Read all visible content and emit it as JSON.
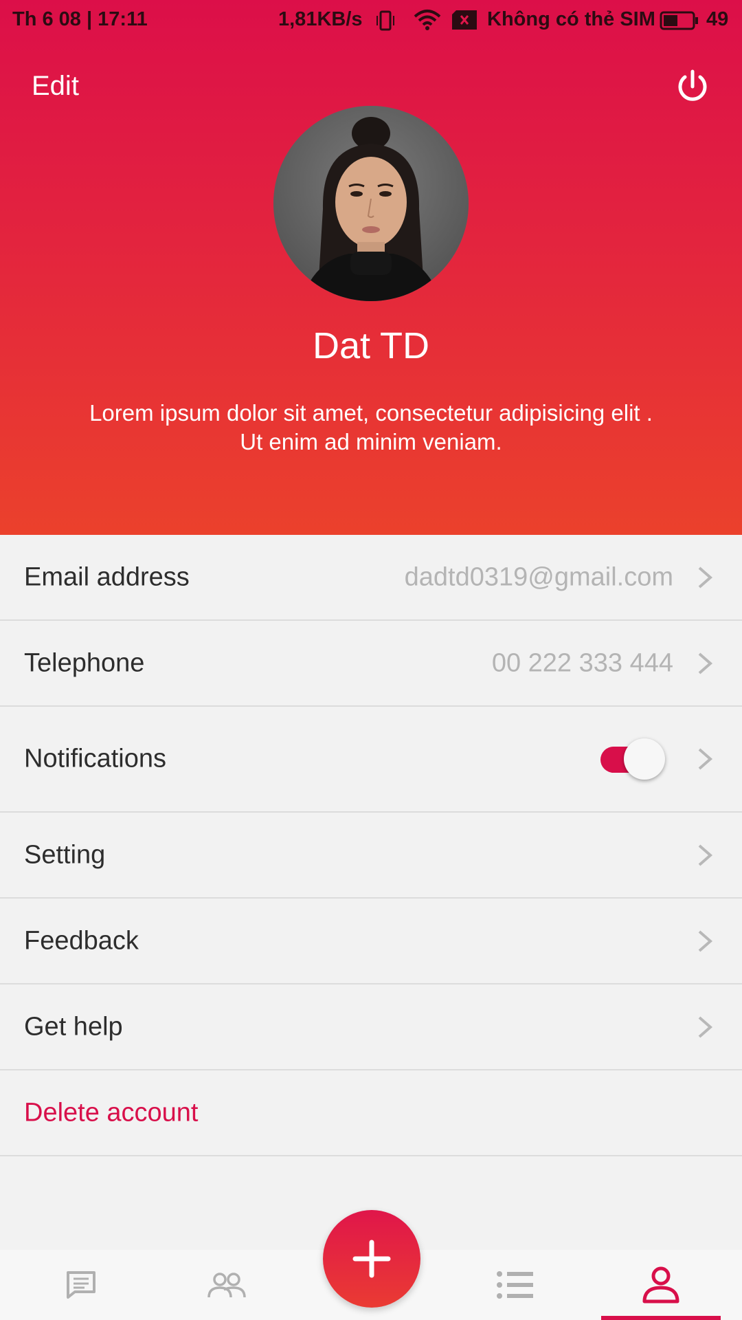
{
  "status_bar": {
    "datetime": "Th 6 08 | 17:11",
    "network_speed": "1,81KB/s",
    "carrier": "Không có thẻ SIM",
    "battery_level": "49"
  },
  "header": {
    "edit_label": "Edit",
    "name": "Dat TD",
    "bio_line1": "Lorem ipsum dolor sit amet, consectetur adipisicing elit .",
    "bio_line2": "Ut enim ad minim veniam."
  },
  "settings": {
    "email": {
      "label": "Email address",
      "value": "dadtd0319@gmail.com"
    },
    "telephone": {
      "label": "Telephone",
      "value": "00 222 333 444"
    },
    "notifications": {
      "label": "Notifications",
      "enabled": true
    },
    "setting": {
      "label": "Setting"
    },
    "feedback": {
      "label": "Feedback"
    },
    "help": {
      "label": "Get help"
    },
    "delete": {
      "label": "Delete account"
    }
  },
  "bottom_nav": {
    "items": [
      "chat-icon",
      "contacts-icon",
      "add-icon",
      "list-icon",
      "profile-icon"
    ],
    "active": "profile-icon"
  },
  "colors": {
    "accent": "#d80f4a",
    "header_top": "#dc0f49",
    "header_bottom": "#eb412c"
  }
}
